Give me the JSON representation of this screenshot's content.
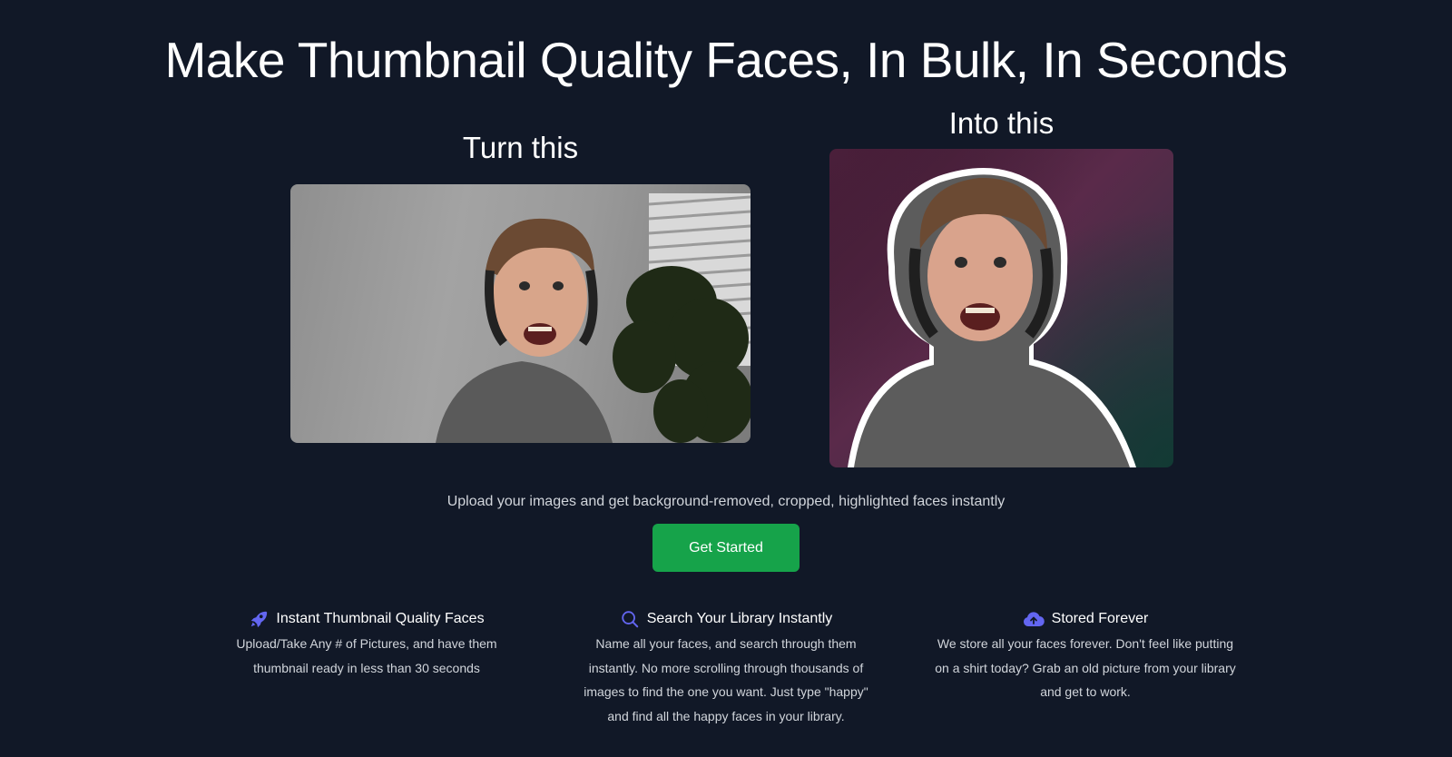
{
  "hero": {
    "title": "Make Thumbnail Quality Faces, In Bulk, In Seconds"
  },
  "comparison": {
    "before_label": "Turn this",
    "after_label": "Into this"
  },
  "cta": {
    "text": "Upload your images and get background-removed, cropped, highlighted faces instantly",
    "button_label": "Get Started",
    "button_color": "#16a34a"
  },
  "features": [
    {
      "icon": "rocket-icon",
      "title": "Instant Thumbnail Quality Faces",
      "body": "Upload/Take Any # of Pictures, and have them thumbnail ready in less than 30 seconds"
    },
    {
      "icon": "search-icon",
      "title": "Search Your Library Instantly",
      "body": "Name all your faces, and search through them instantly. No more scrolling through thousands of images to find the one you want. Just type \"happy\" and find all the happy faces in your library."
    },
    {
      "icon": "cloud-upload-icon",
      "title": "Stored Forever",
      "body": "We store all your faces forever. Don't feel like putting on a shirt today? Grab an old picture from your library and get to work."
    }
  ],
  "colors": {
    "background": "#111827",
    "icon_accent": "#6366f1"
  }
}
